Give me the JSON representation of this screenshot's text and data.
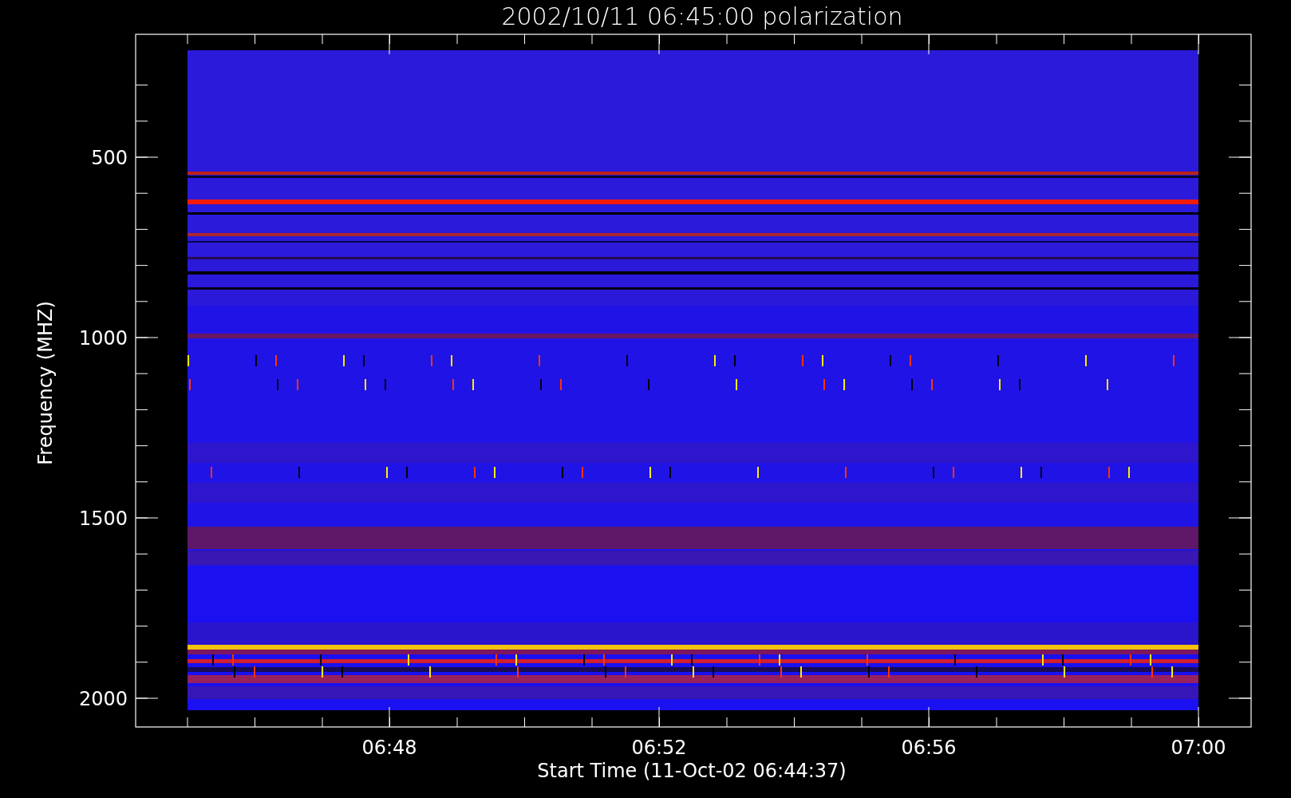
{
  "title": "2002/10/11 06:45:00 polarization",
  "y_axis": {
    "label": "Frequency (MHZ)",
    "ticks": [
      "500",
      "1000",
      "1500",
      "2000"
    ]
  },
  "x_axis": {
    "label": "Start Time (11-Oct-02 06:44:37)",
    "ticks": [
      "06:48",
      "06:52",
      "06:56",
      "07:00"
    ]
  }
}
